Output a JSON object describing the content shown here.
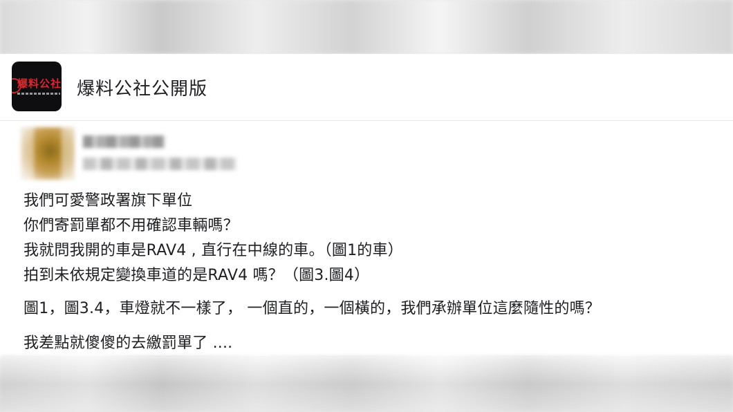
{
  "group": {
    "name": "爆料公社公開版",
    "logo_text": "爆料公社"
  },
  "post": {
    "lines": [
      "我們可愛警政署旗下單位",
      "你們寄罰單都不用確認車輛嗎？",
      "我就問我開的車是RAV4 , 直行在中線的車。（圖1的車）",
      "拍到未依規定變換車道的是RAV4 嗎？（圖3.圖4）",
      "圖1，圖3.4，車燈就不一樣了， 一個直的，一個橫的，我們承辦單位這麼隨性的嗎？",
      "我差點就傻傻的去繳罰單了 ...."
    ]
  },
  "colors": {
    "card_bg": "#ffffff",
    "text": "#1c1e21",
    "logo_red": "#e0252c",
    "logo_bg": "#0e0e10"
  }
}
